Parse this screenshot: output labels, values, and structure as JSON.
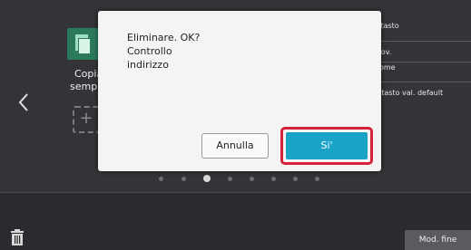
{
  "side_menu": {
    "items": [
      {
        "label": "a tasto"
      },
      {
        "label": "mov."
      },
      {
        "label": "Nome"
      },
      {
        "label": "t. tasto val. default"
      }
    ]
  },
  "home": {
    "tile_label_line1": "Copia",
    "tile_label_line2": "sempli",
    "add_symbol": "+"
  },
  "dialog": {
    "message_lines": [
      "Eliminare. OK?",
      "Controllo",
      "indirizzo"
    ],
    "cancel_label": "Annulla",
    "confirm_label": "Si'"
  },
  "pager": {
    "count": 8,
    "active_index": 2
  },
  "bottom": {
    "done_label": "Mod. fine"
  },
  "colors": {
    "accent": "#1aa3c7",
    "highlight": "#d3223a",
    "background": "#333437"
  }
}
